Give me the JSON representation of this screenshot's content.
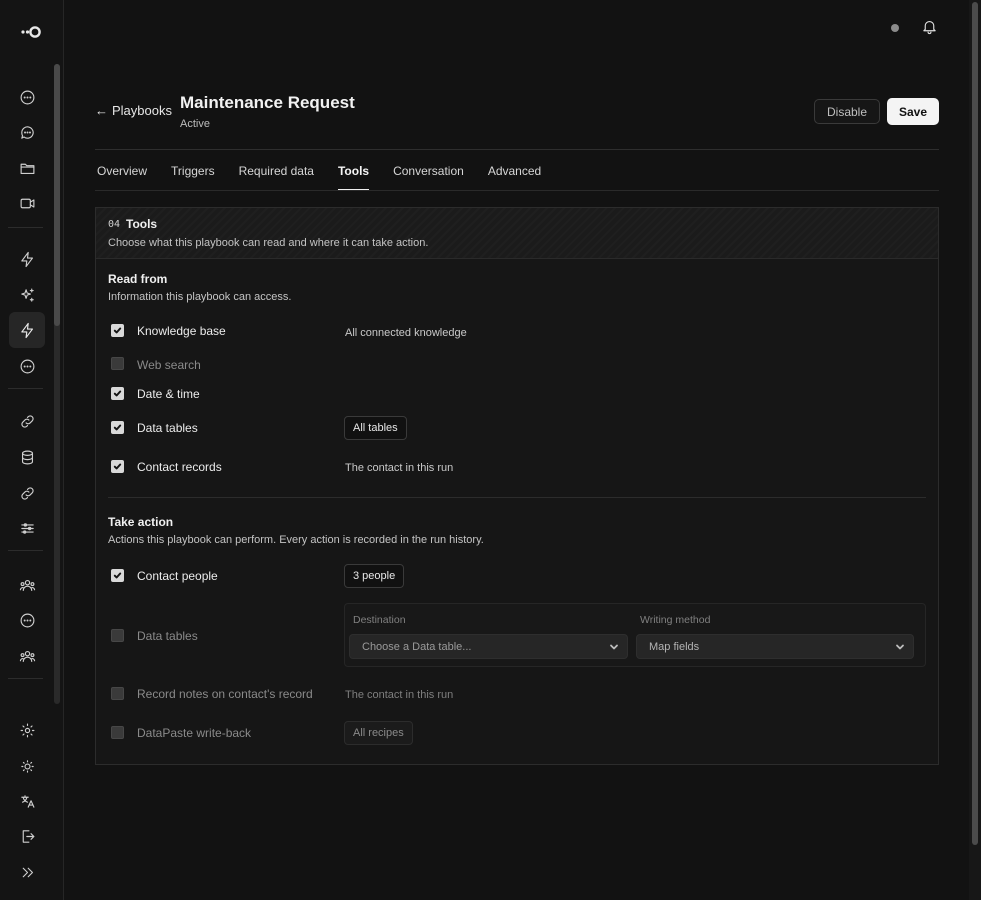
{
  "header": {
    "back_label": "Playbooks",
    "title": "Maintenance Request",
    "status": "Active",
    "disable_label": "Disable",
    "save_label": "Save"
  },
  "tabs": [
    {
      "label": "Overview"
    },
    {
      "label": "Triggers"
    },
    {
      "label": "Required data"
    },
    {
      "label": "Tools",
      "active": true
    },
    {
      "label": "Conversation"
    },
    {
      "label": "Advanced"
    }
  ],
  "card": {
    "number": "04",
    "title": "Tools",
    "description": "Choose what this playbook can read and where it can take action."
  },
  "read_from": {
    "title": "Read from",
    "description": "Information this playbook can access.",
    "items": [
      {
        "label": "Knowledge base",
        "checked": true,
        "note": "All connected knowledge"
      },
      {
        "label": "Web search",
        "checked": false
      },
      {
        "label": "Date & time",
        "checked": true
      },
      {
        "label": "Data tables",
        "checked": true,
        "pill": "All tables"
      },
      {
        "label": "Contact records",
        "checked": true,
        "note": "The contact in this run"
      }
    ]
  },
  "take_action": {
    "title": "Take action",
    "description": "Actions this playbook can perform. Every action is recorded in the run history.",
    "items": [
      {
        "label": "Contact people",
        "checked": true,
        "pill": "3 people"
      },
      {
        "label": "Data tables",
        "checked": false
      },
      {
        "label": "Record notes on contact's record",
        "checked": false,
        "note": "The contact in this run"
      },
      {
        "label": "DataPaste write-back",
        "checked": false,
        "pill": "All recipes"
      }
    ],
    "destination": {
      "label": "Destination",
      "value": "Choose a Data table...",
      "method_label": "Writing method",
      "method_value": "Map fields"
    }
  },
  "sidebar_icons": [
    "message-icon",
    "message-icon",
    "folder-icon",
    "video-icon",
    "bolt-icon",
    "sparkles-icon",
    "bolt-icon",
    "message-icon",
    "link-icon",
    "database-icon",
    "link-icon",
    "sliders-icon",
    "users-icon",
    "message-icon",
    "users-icon",
    "settings-icon",
    "sun-icon",
    "translate-icon",
    "logout-icon",
    "expand-icon"
  ]
}
